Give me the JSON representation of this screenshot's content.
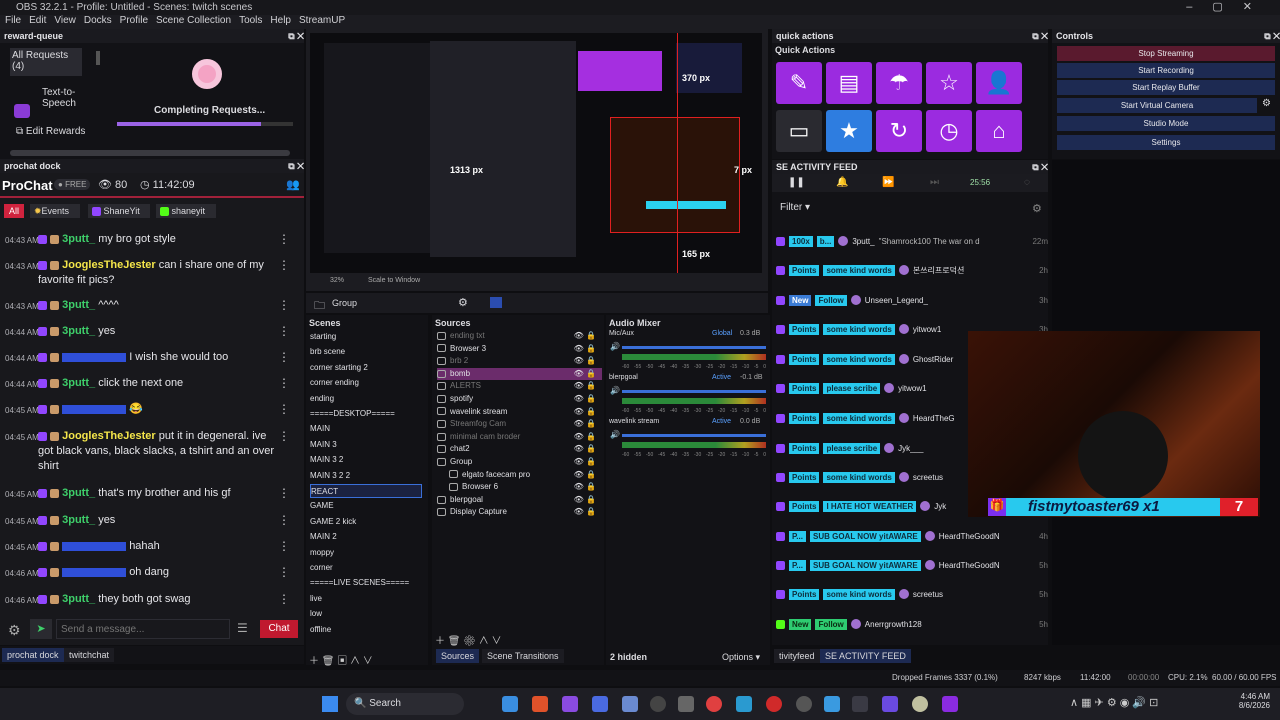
{
  "window": {
    "title": "OBS 32.2.1 - Profile: Untitled - Scenes: twitch scenes"
  },
  "menu": [
    "File",
    "Edit",
    "View",
    "Docks",
    "Profile",
    "Scene Collection",
    "Tools",
    "Help",
    "StreamUP"
  ],
  "reward_queue": {
    "title": "reward-queue",
    "all_requests": "All Requests (4)",
    "tts": "Text-to-Speech",
    "status": "Completing Requests...",
    "edit": "Edit Rewards"
  },
  "prochat": {
    "dock_title": "prochat dock",
    "name": "ProChat",
    "plan": "FREE",
    "viewers": "80",
    "clock": "11:42:09",
    "filters": [
      "All",
      "Events",
      "ShaneYit",
      "shaneyit"
    ],
    "messages": [
      {
        "time": "04:43 AM",
        "user": "3putt_",
        "text": "my bro got style"
      },
      {
        "time": "04:43 AM",
        "user": "JooglesTheJester",
        "text": "can i share one of my favorite fit pics?"
      },
      {
        "time": "04:43 AM",
        "user": "3putt_",
        "text": "^^^^"
      },
      {
        "time": "04:44 AM",
        "user": "3putt_",
        "text": "yes"
      },
      {
        "time": "04:44 AM",
        "user": "",
        "text": "I wish she would too"
      },
      {
        "time": "04:44 AM",
        "user": "3putt_",
        "text": "click the next one"
      },
      {
        "time": "04:45 AM",
        "user": "",
        "text": "😂"
      },
      {
        "time": "04:45 AM",
        "user": "JooglesTheJester",
        "text": "put it in degeneral. ive got black vans, black slacks, a tshirt and an over shirt"
      },
      {
        "time": "04:45 AM",
        "user": "3putt_",
        "text": "that's my brother and his gf"
      },
      {
        "time": "04:45 AM",
        "user": "3putt_",
        "text": "yes"
      },
      {
        "time": "04:45 AM",
        "user": "",
        "text": "hahah"
      },
      {
        "time": "04:46 AM",
        "user": "",
        "text": "oh dang"
      },
      {
        "time": "04:46 AM",
        "user": "3putt_",
        "text": "they both got swag"
      }
    ],
    "input_placeholder": "Send a message...",
    "chat_btn": "Chat"
  },
  "bottom_tabs_left": [
    "prochat dock",
    "twitchchat"
  ],
  "preview": {
    "zoom": "32%",
    "scale": "Scale to Window",
    "px1": "1313 px",
    "px2": "370 px",
    "px3": "7 px",
    "px4": "165 px",
    "overlay_text": "fistmytoaster69 x1"
  },
  "group_bar": {
    "label": "Group"
  },
  "scenes": {
    "title": "Scenes",
    "items": [
      "starting",
      "brb scene",
      "corner starting 2",
      "corner ending",
      "ending",
      "=====DESKTOP=====",
      "MAIN",
      "MAIN 3",
      "MAIN 3 2",
      "MAIN 3 2 2",
      "REACT",
      "GAME",
      "GAME 2 kick",
      "MAIN 2",
      "moppy",
      "corner",
      "=====LIVE SCENES=====",
      "live",
      "low",
      "offline"
    ],
    "selected": "REACT"
  },
  "sources": {
    "title": "Sources",
    "items": [
      "ending txt",
      "Browser 3",
      "brb 2",
      "bomb",
      "ALERTS",
      "spotify",
      "wavelink stream",
      "Streamfog Cam",
      "minimal cam broder",
      "chat2",
      "Group",
      "elgato facecam pro",
      "Browser 6",
      "blerpgoal",
      "Display Capture"
    ],
    "selected": "bomb"
  },
  "source_tabs": [
    "Sources",
    "Scene Transitions"
  ],
  "mixer": {
    "title": "Audio Mixer",
    "channels": [
      {
        "name": "Mic/Aux",
        "tag": "Global",
        "db": "0.3 dB"
      },
      {
        "name": "blerpgoal",
        "tag": "Active",
        "db": "-0.1 dB"
      },
      {
        "name": "wavelink stream",
        "tag": "Active",
        "db": "0.0 dB"
      }
    ],
    "scale": [
      "-60",
      "-55",
      "-50",
      "-45",
      "-40",
      "-35",
      "-30",
      "-25",
      "-20",
      "-15",
      "-10",
      "-5",
      "0"
    ],
    "hidden": "2 hidden",
    "options": "Options"
  },
  "quick_actions": {
    "dock_title": "quick actions",
    "title": "Quick Actions"
  },
  "activity": {
    "dock_title": "SE ACTIVITY FEED",
    "timer": "25:56",
    "filter": "Filter",
    "rows": [
      {
        "tag": "100x",
        "tagtype": "cyan",
        "label": "b...",
        "user": "3putt_",
        "msg": "\"Shamrock100 The war on d",
        "age": "22m"
      },
      {
        "tag": "Points",
        "tagtype": "cyan",
        "label": "some kind words",
        "user": "본쓰리프로덕션",
        "msg": "",
        "age": "2h"
      },
      {
        "tag": "New",
        "tagtype": "blue",
        "label": "Follow",
        "user": "Unseen_Legend_",
        "msg": "",
        "age": "3h"
      },
      {
        "tag": "Points",
        "tagtype": "cyan",
        "label": "some kind words",
        "user": "yitwow1",
        "msg": "",
        "age": "3h"
      },
      {
        "tag": "Points",
        "tagtype": "cyan",
        "label": "some kind words",
        "user": "GhostRider",
        "msg": "",
        "age": ""
      },
      {
        "tag": "Points",
        "tagtype": "cyan",
        "label": "please scribe",
        "user": "yitwow1",
        "msg": "",
        "age": ""
      },
      {
        "tag": "Points",
        "tagtype": "cyan",
        "label": "some kind words",
        "user": "HeardTheG",
        "msg": "",
        "age": ""
      },
      {
        "tag": "Points",
        "tagtype": "cyan",
        "label": "please scribe",
        "user": "Jyk___",
        "msg": "",
        "age": ""
      },
      {
        "tag": "Points",
        "tagtype": "cyan",
        "label": "some kind words",
        "user": "screetus",
        "msg": "",
        "age": ""
      },
      {
        "tag": "Points",
        "tagtype": "cyan",
        "label": "I HATE HOT WEATHER",
        "user": "Jyk",
        "msg": "",
        "age": ""
      },
      {
        "tag": "P...",
        "tagtype": "cyan",
        "label": "SUB GOAL NOW yitAWARE",
        "user": "HeardTheGoodN",
        "msg": "",
        "age": "4h"
      },
      {
        "tag": "P...",
        "tagtype": "cyan",
        "label": "SUB GOAL NOW yitAWARE",
        "user": "HeardTheGoodN",
        "msg": "",
        "age": "5h"
      },
      {
        "tag": "Points",
        "tagtype": "cyan",
        "label": "some kind words",
        "user": "screetus",
        "msg": "",
        "age": "5h"
      },
      {
        "tag": "New",
        "tagtype": "green",
        "label": "Follow",
        "user": "Anerrgrowth128",
        "msg": "",
        "age": "5h"
      }
    ]
  },
  "controls": {
    "title": "Controls",
    "buttons": [
      "Stop Streaming",
      "Start Recording",
      "Start Replay Buffer",
      "Start Virtual Camera",
      "Studio Mode",
      "Settings"
    ]
  },
  "bottom_tabs_mid": [
    "tivityfeed",
    "SE ACTIVITY FEED"
  ],
  "webcam": {
    "banner": "fistmytoaster69 x1"
  },
  "statusbar": {
    "dropped": "Dropped Frames 3337 (0.1%)",
    "kbps": "8247 kbps",
    "live": "11:42:00",
    "rec": "00:00:00",
    "cpu": "CPU: 2.1%",
    "fps": "60.00 / 60.00 FPS"
  },
  "taskbar": {
    "search": "Search",
    "time": "4:46 AM",
    "date": "8/6/2026"
  }
}
